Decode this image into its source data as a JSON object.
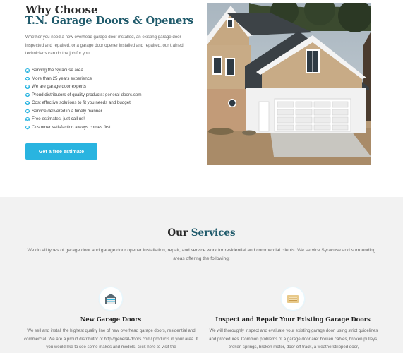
{
  "why": {
    "title_line1": "Why Choose",
    "title_line2": "T.N. Garage Doors & Openers",
    "intro": "Whether you need a new overhead garage door installed, an existing garage door inspected and repaired, or a garage door opener installed and repaired, our trained technicians can do the job for you!",
    "checklist": [
      "Serving the Syracuse area",
      "More than 25 years experience",
      "We are garage door experts",
      "Proud distributors of quality products:",
      "Cost effective solutions to fit you needs and budget",
      "Service delivered in a timely manner",
      "Free estimates, just call us!",
      "Customer satisfaction always comes first"
    ],
    "distributor_link": "general-doors.com",
    "cta_label": "Get a free estimate"
  },
  "services": {
    "heading_plain": "Our",
    "heading_accent": "Services",
    "intro": "We do all types of garage door and garage door opener installation, repair, and service work for residential and commercial clients. We service Syracuse and surrounding areas offering the following:",
    "items": [
      {
        "title": "New Garage Doors",
        "body": "We sell and install the highest quality line of new overhead garage doors, residential and commercial. We are a proud distributor of http://general-doors.com/ products in your area. If you would like to see some makes and models, click here to visit the",
        "icon": "garage-door-icon"
      },
      {
        "title": "Inspect and Repair Your Existing Garage Doors",
        "body": "We will thoroughly inspect and evaluate your existing garage door, using strict guidelines and procedures. Common problems of a garage door are: broken cables, broken pulleys, broken springs, broken motor, door off track, a weatherstripped door,",
        "icon": "garage-door-repair-icon"
      }
    ]
  },
  "colors": {
    "accent": "#29b4e0",
    "heading_teal": "#1f5a6b",
    "services_bg": "#f2f2f2"
  }
}
